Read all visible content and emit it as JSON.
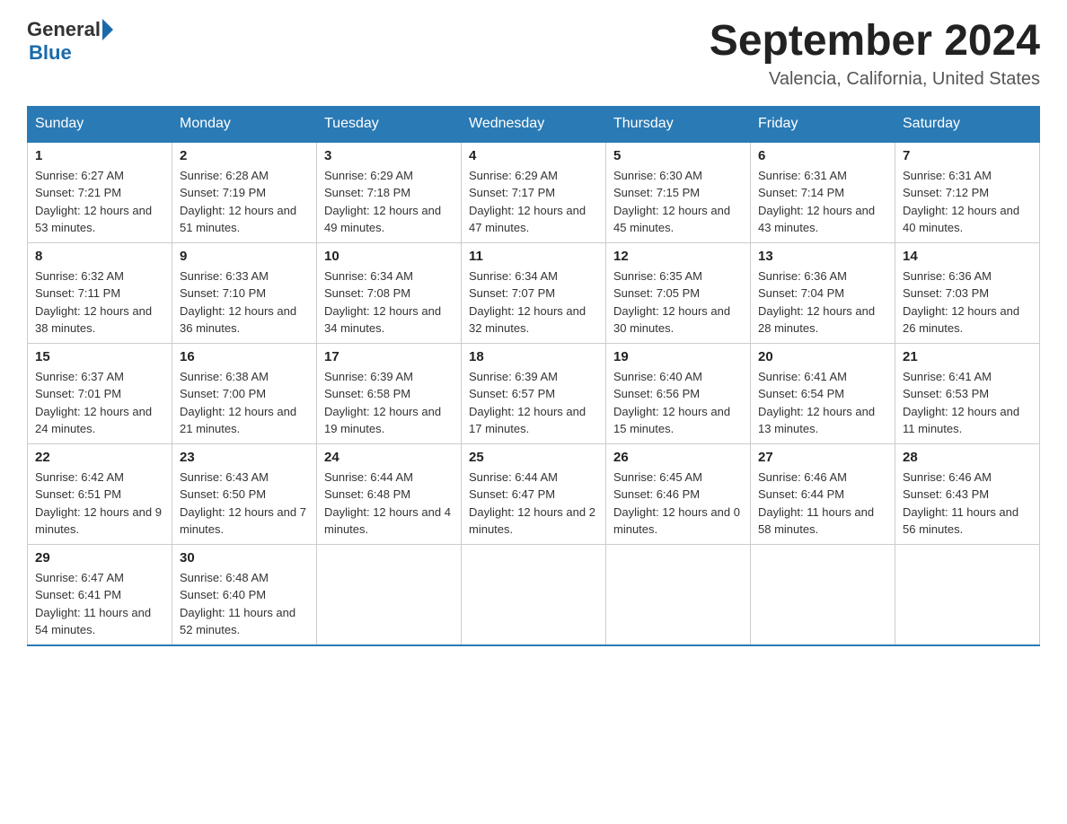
{
  "header": {
    "logo_general": "General",
    "logo_blue": "Blue",
    "title": "September 2024",
    "location": "Valencia, California, United States"
  },
  "columns": [
    "Sunday",
    "Monday",
    "Tuesday",
    "Wednesday",
    "Thursday",
    "Friday",
    "Saturday"
  ],
  "weeks": [
    [
      {
        "day": "1",
        "sunrise": "6:27 AM",
        "sunset": "7:21 PM",
        "daylight": "12 hours and 53 minutes."
      },
      {
        "day": "2",
        "sunrise": "6:28 AM",
        "sunset": "7:19 PM",
        "daylight": "12 hours and 51 minutes."
      },
      {
        "day": "3",
        "sunrise": "6:29 AM",
        "sunset": "7:18 PM",
        "daylight": "12 hours and 49 minutes."
      },
      {
        "day": "4",
        "sunrise": "6:29 AM",
        "sunset": "7:17 PM",
        "daylight": "12 hours and 47 minutes."
      },
      {
        "day": "5",
        "sunrise": "6:30 AM",
        "sunset": "7:15 PM",
        "daylight": "12 hours and 45 minutes."
      },
      {
        "day": "6",
        "sunrise": "6:31 AM",
        "sunset": "7:14 PM",
        "daylight": "12 hours and 43 minutes."
      },
      {
        "day": "7",
        "sunrise": "6:31 AM",
        "sunset": "7:12 PM",
        "daylight": "12 hours and 40 minutes."
      }
    ],
    [
      {
        "day": "8",
        "sunrise": "6:32 AM",
        "sunset": "7:11 PM",
        "daylight": "12 hours and 38 minutes."
      },
      {
        "day": "9",
        "sunrise": "6:33 AM",
        "sunset": "7:10 PM",
        "daylight": "12 hours and 36 minutes."
      },
      {
        "day": "10",
        "sunrise": "6:34 AM",
        "sunset": "7:08 PM",
        "daylight": "12 hours and 34 minutes."
      },
      {
        "day": "11",
        "sunrise": "6:34 AM",
        "sunset": "7:07 PM",
        "daylight": "12 hours and 32 minutes."
      },
      {
        "day": "12",
        "sunrise": "6:35 AM",
        "sunset": "7:05 PM",
        "daylight": "12 hours and 30 minutes."
      },
      {
        "day": "13",
        "sunrise": "6:36 AM",
        "sunset": "7:04 PM",
        "daylight": "12 hours and 28 minutes."
      },
      {
        "day": "14",
        "sunrise": "6:36 AM",
        "sunset": "7:03 PM",
        "daylight": "12 hours and 26 minutes."
      }
    ],
    [
      {
        "day": "15",
        "sunrise": "6:37 AM",
        "sunset": "7:01 PM",
        "daylight": "12 hours and 24 minutes."
      },
      {
        "day": "16",
        "sunrise": "6:38 AM",
        "sunset": "7:00 PM",
        "daylight": "12 hours and 21 minutes."
      },
      {
        "day": "17",
        "sunrise": "6:39 AM",
        "sunset": "6:58 PM",
        "daylight": "12 hours and 19 minutes."
      },
      {
        "day": "18",
        "sunrise": "6:39 AM",
        "sunset": "6:57 PM",
        "daylight": "12 hours and 17 minutes."
      },
      {
        "day": "19",
        "sunrise": "6:40 AM",
        "sunset": "6:56 PM",
        "daylight": "12 hours and 15 minutes."
      },
      {
        "day": "20",
        "sunrise": "6:41 AM",
        "sunset": "6:54 PM",
        "daylight": "12 hours and 13 minutes."
      },
      {
        "day": "21",
        "sunrise": "6:41 AM",
        "sunset": "6:53 PM",
        "daylight": "12 hours and 11 minutes."
      }
    ],
    [
      {
        "day": "22",
        "sunrise": "6:42 AM",
        "sunset": "6:51 PM",
        "daylight": "12 hours and 9 minutes."
      },
      {
        "day": "23",
        "sunrise": "6:43 AM",
        "sunset": "6:50 PM",
        "daylight": "12 hours and 7 minutes."
      },
      {
        "day": "24",
        "sunrise": "6:44 AM",
        "sunset": "6:48 PM",
        "daylight": "12 hours and 4 minutes."
      },
      {
        "day": "25",
        "sunrise": "6:44 AM",
        "sunset": "6:47 PM",
        "daylight": "12 hours and 2 minutes."
      },
      {
        "day": "26",
        "sunrise": "6:45 AM",
        "sunset": "6:46 PM",
        "daylight": "12 hours and 0 minutes."
      },
      {
        "day": "27",
        "sunrise": "6:46 AM",
        "sunset": "6:44 PM",
        "daylight": "11 hours and 58 minutes."
      },
      {
        "day": "28",
        "sunrise": "6:46 AM",
        "sunset": "6:43 PM",
        "daylight": "11 hours and 56 minutes."
      }
    ],
    [
      {
        "day": "29",
        "sunrise": "6:47 AM",
        "sunset": "6:41 PM",
        "daylight": "11 hours and 54 minutes."
      },
      {
        "day": "30",
        "sunrise": "6:48 AM",
        "sunset": "6:40 PM",
        "daylight": "11 hours and 52 minutes."
      },
      null,
      null,
      null,
      null,
      null
    ]
  ]
}
